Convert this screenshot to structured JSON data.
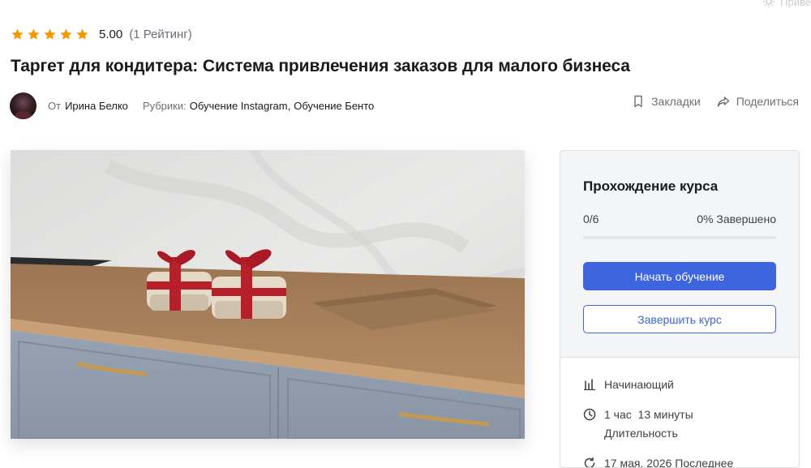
{
  "corner": {
    "label": "Приве"
  },
  "rating": {
    "stars": 5,
    "value": "5.00",
    "count": "(1 Рейтинг)",
    "star_color": "#f29900"
  },
  "course": {
    "title": "Таргет для кондитера: Система привлечения заказов для малого бизнеса"
  },
  "meta": {
    "by": "От",
    "author": "Ирина Белко",
    "categories_label": "Рубрики:",
    "categories": [
      "Обучение Instagram",
      "Обучение Бенто"
    ],
    "separator": ","
  },
  "actions": {
    "bookmarks": "Закладки",
    "share": "Поделиться"
  },
  "progress_card": {
    "title": "Прохождение курса",
    "lessons": "0/6",
    "completed": "0% Завершено",
    "progress_fraction": 0,
    "start_button": "Начать обучение",
    "finish_button": "Завершить курс",
    "accent": "#3e64de"
  },
  "details": {
    "level": "Начинающий",
    "duration_value": "1 час  13 минуты",
    "duration_label": "Длительность",
    "updated": "17 мая, 2026 Последнее"
  }
}
